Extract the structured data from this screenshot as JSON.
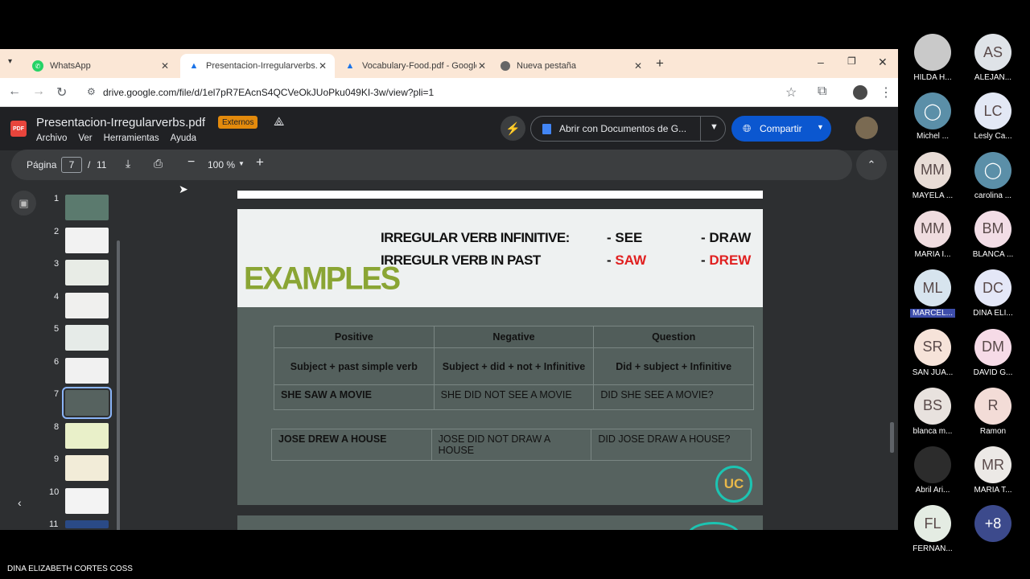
{
  "browser": {
    "tabs": [
      {
        "label": "WhatsApp",
        "icon": "whatsapp-icon"
      },
      {
        "label": "Presentacion-Irregularverbs.pdf",
        "icon": "drive-icon",
        "active": true
      },
      {
        "label": "Vocabulary-Food.pdf - Google",
        "icon": "drive-icon"
      },
      {
        "label": "Nueva pestaña",
        "icon": "chrome-icon"
      }
    ],
    "url": "drive.google.com/file/d/1el7pR7EAcnS4QCVeOkJUoPku049KI-3w/view?pli=1"
  },
  "drive": {
    "file_name": "Presentacion-Irregularverbs.pdf",
    "badge": "Externos",
    "menu": [
      "Archivo",
      "Ver",
      "Herramientas",
      "Ayuda"
    ],
    "open_with": "Abrir con Documentos de G...",
    "share": "Compartir",
    "pdf_icon_text": "PDF"
  },
  "pdf_toolbar": {
    "page_label": "Página",
    "current_page": "7",
    "separator": "/",
    "total_pages": "11",
    "zoom": "100 %"
  },
  "thumbnails": [
    "1",
    "2",
    "3",
    "4",
    "5",
    "6",
    "7",
    "8",
    "9",
    "10",
    "11"
  ],
  "slide": {
    "examples": "EXAMPLES",
    "row1_label": "IRREGULAR VERB  INFINITIVE:",
    "row2_label": "IRREGULR VERB IN PAST",
    "see": "- SEE",
    "draw": "- DRAW",
    "saw_dash": "- ",
    "saw": "SAW",
    "drew_dash": "- ",
    "drew": "DREW",
    "table1": {
      "headers": [
        "Positive",
        "Negative",
        "Question"
      ],
      "structure": [
        "Subject + past simple verb",
        "Subject + did + not + Infinitive",
        "Did + subject + Infinitive"
      ],
      "example": [
        "SHE SAW A MOVIE",
        "SHE DID NOT SEE A MOVIE",
        "DID SHE SEE A MOVIE?"
      ]
    },
    "table2": [
      "JOSE DREW A HOUSE",
      "JOSE DID NOT DRAW A HOUSE",
      "DID JOSE DRAW A HOUSE?"
    ],
    "logo": "UC"
  },
  "participants": [
    {
      "initials": "",
      "name": "HILDA H...",
      "color": "#c9c9c9",
      "photo": true
    },
    {
      "initials": "AS",
      "name": "ALEJAN...",
      "color": "#dfe3e8"
    },
    {
      "initials": "",
      "name": "Michel ...",
      "color": "#5b8fa8",
      "generic": true
    },
    {
      "initials": "LC",
      "name": "Lesly Ca...",
      "color": "#e3e8f5"
    },
    {
      "initials": "MM",
      "name": "MAYELA ...",
      "color": "#e8dcd6"
    },
    {
      "initials": "",
      "name": "carolina ...",
      "color": "#5b8fa8",
      "generic": true
    },
    {
      "initials": "MM",
      "name": "MARIA I...",
      "color": "#efdcdf"
    },
    {
      "initials": "BM",
      "name": "BLANCA ...",
      "color": "#f2dde6"
    },
    {
      "initials": "ML",
      "name": "MARCEL...",
      "color": "#d7e4ee",
      "highlight": true
    },
    {
      "initials": "DC",
      "name": "DINA ELI...",
      "color": "#e4e7f7"
    },
    {
      "initials": "SR",
      "name": "SAN JUA...",
      "color": "#f6e3d9"
    },
    {
      "initials": "DM",
      "name": "DAVID G...",
      "color": "#f6dbe7"
    },
    {
      "initials": "BS",
      "name": "blanca m...",
      "color": "#e8e2de"
    },
    {
      "initials": "R",
      "name": "Ramon",
      "color": "#f3dcd7"
    },
    {
      "initials": "",
      "name": "Abril Ari...",
      "color": "#2c2c2c",
      "photo": true
    },
    {
      "initials": "MR",
      "name": "MARIA T...",
      "color": "#ece9e6"
    },
    {
      "initials": "FL",
      "name": "FERNAN...",
      "color": "#e4ece3"
    },
    {
      "initials": "+8",
      "name": "",
      "color": "#3c4a8c"
    }
  ],
  "presenter": "DINA ELIZABETH CORTES COSS"
}
